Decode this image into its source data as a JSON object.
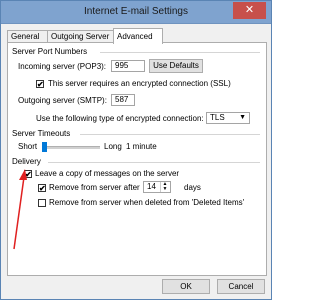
{
  "window": {
    "title": "Internet E-mail Settings",
    "close_glyph": "✕"
  },
  "tabs": [
    {
      "label": "General",
      "active": false
    },
    {
      "label": "Outgoing Server",
      "active": false
    },
    {
      "label": "Advanced",
      "active": true
    }
  ],
  "server_ports": {
    "heading": "Server Port Numbers",
    "incoming_label": "Incoming server (POP3):",
    "incoming_value": "995",
    "use_defaults_label": "Use Defaults",
    "ssl_checkbox_label": "This server requires an encrypted connection (SSL)",
    "ssl_checked": true,
    "outgoing_label": "Outgoing server (SMTP):",
    "outgoing_value": "587",
    "encryption_label": "Use the following type of encrypted connection:",
    "encryption_value": "TLS"
  },
  "timeouts": {
    "heading": "Server Timeouts",
    "short_label": "Short",
    "long_label": "Long",
    "value_label": "1 minute",
    "slider_fraction": 0.0
  },
  "delivery": {
    "heading": "Delivery",
    "leave_copy_label": "Leave a copy of messages on the server",
    "leave_copy_checked": true,
    "remove_after_label": "Remove from server after",
    "remove_after_checked": true,
    "remove_after_value": "14",
    "days_label": "days",
    "remove_deleted_label": "Remove from server when deleted from 'Deleted Items'",
    "remove_deleted_checked": false
  },
  "buttons": {
    "ok": "OK",
    "cancel": "Cancel"
  },
  "colors": {
    "annotation_arrow": "#e02020",
    "titlebar": "#7fa3cf",
    "close": "#c7504b",
    "slider_accent": "#0078d7"
  },
  "check_glyph": "✔"
}
